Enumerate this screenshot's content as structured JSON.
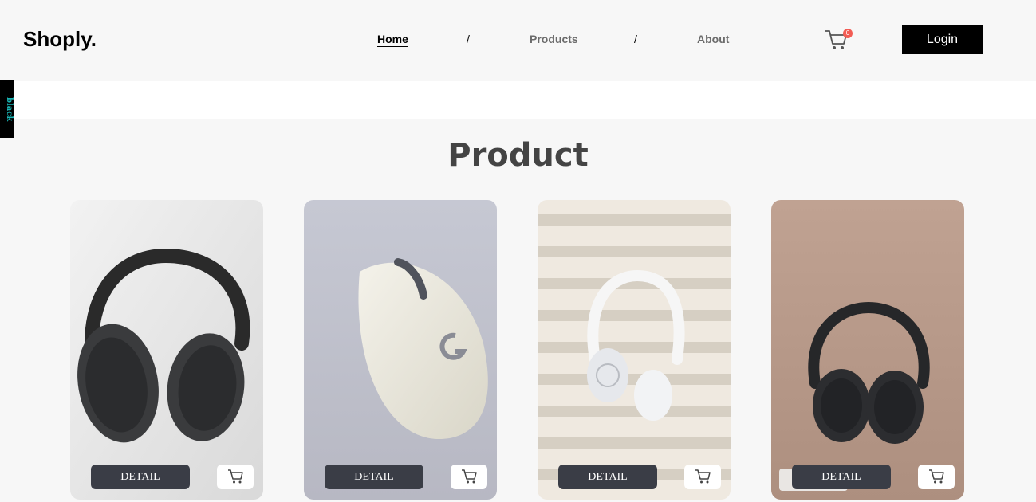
{
  "header": {
    "brand": "Shoply.",
    "nav": [
      "Home",
      "Products",
      "About"
    ],
    "separator": "/",
    "cart_count": "0",
    "login_label": "Login"
  },
  "side_tab": {
    "label": "black"
  },
  "section": {
    "title": "Product"
  },
  "products": [
    {
      "image": "black-headphones-icon",
      "detail_label": "DETAIL"
    },
    {
      "image": "white-mouse-icon",
      "detail_label": "DETAIL"
    },
    {
      "image": "white-headphones-icon",
      "detail_label": "DETAIL"
    },
    {
      "image": "black-headphones-icon",
      "detail_label": "DETAIL"
    }
  ],
  "colors": {
    "accent": "#000000",
    "badge": "#f25c54",
    "button": "#3a3d46",
    "side_tab_text": "#19b3b3"
  }
}
